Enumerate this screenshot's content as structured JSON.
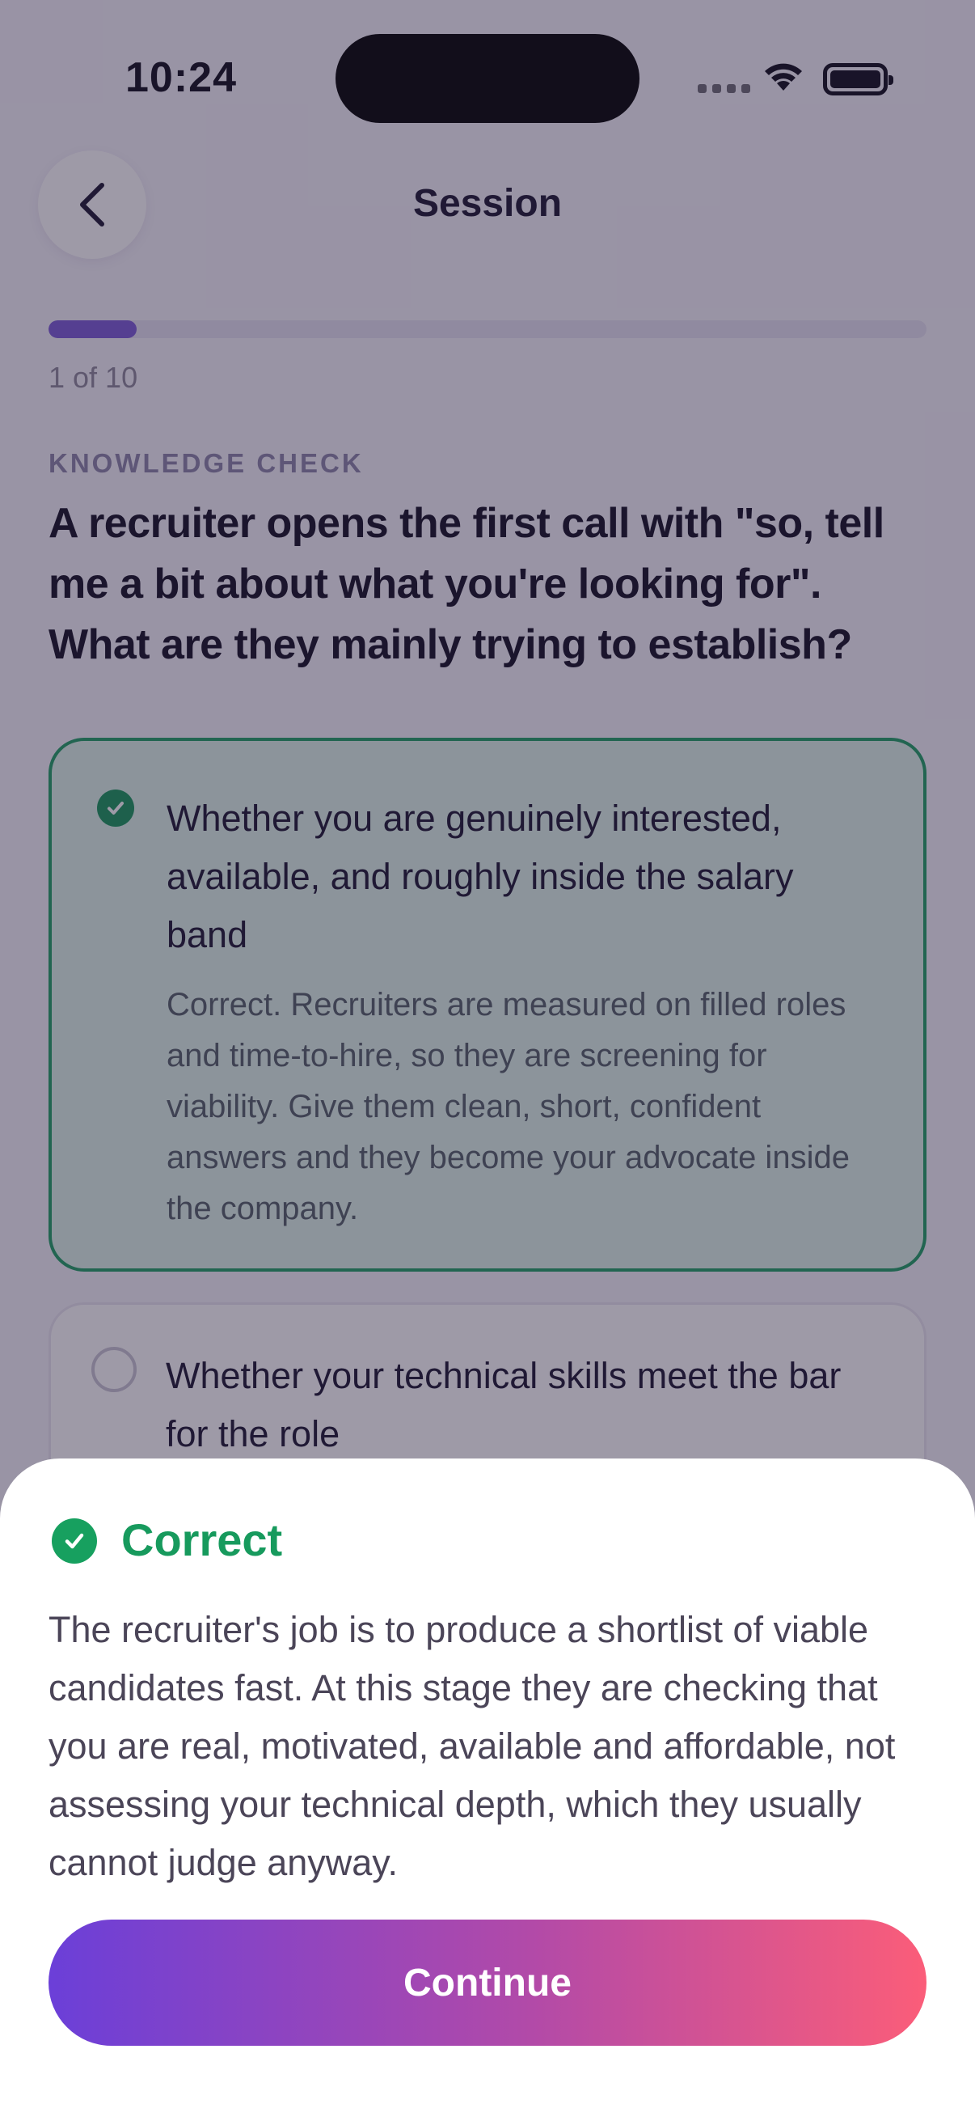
{
  "status_bar": {
    "time": "10:24"
  },
  "header": {
    "title": "Session",
    "back_icon": "chevron-left-icon"
  },
  "progress": {
    "label": "1 of 10",
    "fraction": 0.1
  },
  "question": {
    "eyebrow": "KNOWLEDGE CHECK",
    "text": "A recruiter opens the first call with \"so, tell me a bit about what you're looking for\". What are they mainly trying to establish?"
  },
  "options": [
    {
      "text": "Whether you are genuinely interested, available, and roughly inside the salary band",
      "explanation": "Correct. Recruiters are measured on filled roles and time-to-hire, so they are screening for viability. Give them clean, short, confident answers and they become your advocate inside the company.",
      "state": "correct"
    },
    {
      "text": "Whether your technical skills meet the bar for the role",
      "state": "unselected"
    }
  ],
  "feedback": {
    "title": "Correct",
    "body": "The recruiter's job is to produce a shortlist of viable candidates fast. At this stage they are checking that you are real, motivated, available and affordable, not assessing your technical depth, which they usually cannot judge anyway.",
    "button_label": "Continue"
  },
  "colors": {
    "correct_green": "#17a05f",
    "gradient_start": "#6b3fd8",
    "gradient_end": "#fb5d79"
  }
}
